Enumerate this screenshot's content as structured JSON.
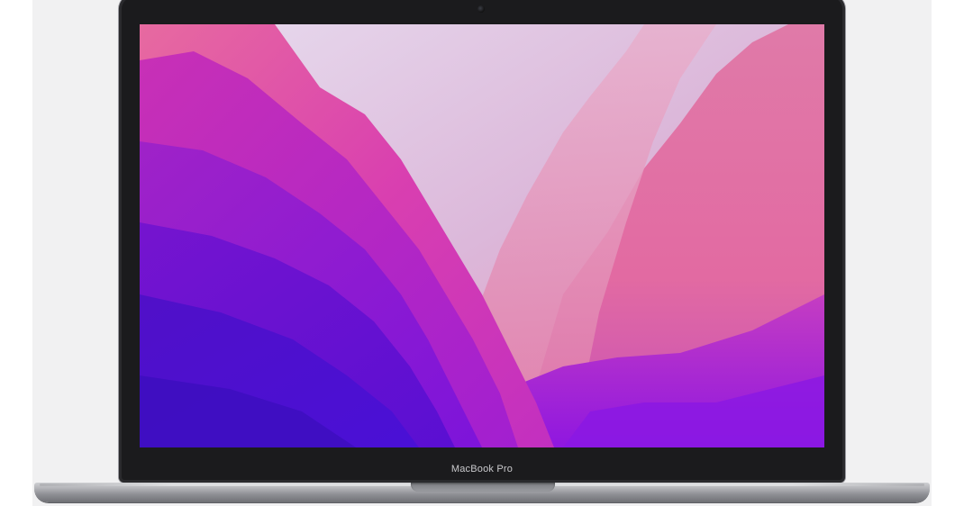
{
  "laptop": {
    "chin_label": "MacBook Pro"
  },
  "colors": {
    "background": "#f1f1f2",
    "bezel": "#1b1b1d",
    "wallpaper_deep_violet": "#4a0fc4",
    "wallpaper_magenta": "#d633b8",
    "wallpaper_pink": "#e06aa6",
    "wallpaper_lavender": "#d8c4e6"
  },
  "wallpaper": {
    "description_name": "purple-magenta-wave-wallpaper"
  }
}
